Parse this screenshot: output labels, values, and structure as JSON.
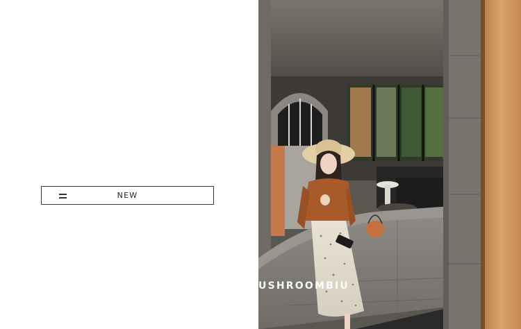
{
  "menu": {
    "icon": "hamburger-icon",
    "label": "NEW"
  },
  "photo": {
    "watermark_text": "USHROOMBIU"
  }
}
